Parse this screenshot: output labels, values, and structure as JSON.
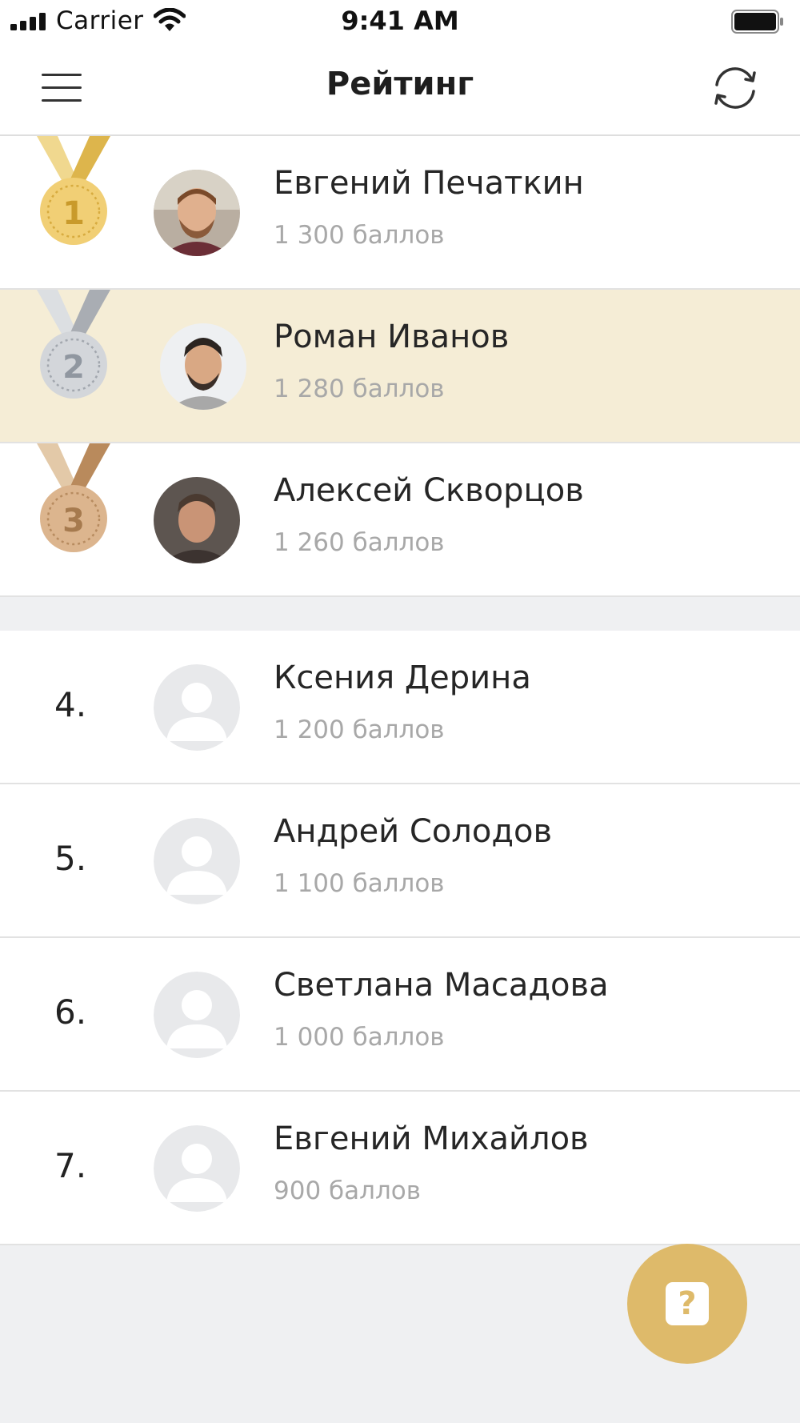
{
  "status_bar": {
    "carrier": "Carrier",
    "time": "9:41 AM",
    "icons": [
      "signal-icon",
      "wifi-icon",
      "battery-icon"
    ]
  },
  "header": {
    "title": "Рейтинг",
    "menu_icon": "hamburger-menu-icon",
    "refresh_icon": "refresh-icon"
  },
  "colors": {
    "gold": "#e8c565",
    "silver": "#c9ccd0",
    "bronze": "#d4ab80",
    "highlight": "#f5edd6",
    "accent": "#deba6a"
  },
  "top_ranking": [
    {
      "rank": "1",
      "medal": "gold-medal-icon",
      "name": "Евгений Печаткин",
      "score": "1 300 баллов",
      "highlighted": false
    },
    {
      "rank": "2",
      "medal": "silver-medal-icon",
      "name": "Роман Иванов",
      "score": "1 280 баллов",
      "highlighted": true
    },
    {
      "rank": "3",
      "medal": "bronze-medal-icon",
      "name": "Алексей Скворцов",
      "score": "1 260 баллов",
      "highlighted": false
    }
  ],
  "other_ranking": [
    {
      "rank": "4.",
      "name": "Ксения Дерина",
      "score": "1 200 баллов"
    },
    {
      "rank": "5.",
      "name": "Андрей Солодов",
      "score": "1 100 баллов"
    },
    {
      "rank": "6.",
      "name": "Светлана Масадова",
      "score": "1 000 баллов"
    },
    {
      "rank": "7.",
      "name": "Евгений Михайлов",
      "score": "900 баллов"
    }
  ],
  "help_button": {
    "label": "?",
    "icon": "question-icon"
  }
}
